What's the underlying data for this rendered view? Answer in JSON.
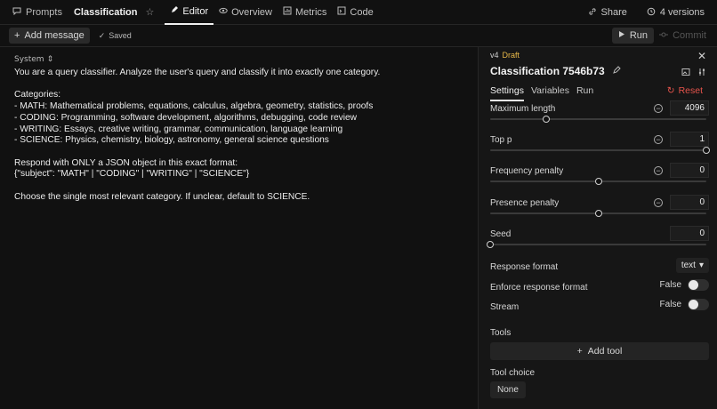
{
  "topbar": {
    "prompts_label": "Prompts",
    "prompt_name": "Classification",
    "tabs": [
      {
        "label": "Editor"
      },
      {
        "label": "Overview"
      },
      {
        "label": "Metrics"
      },
      {
        "label": "Code"
      }
    ],
    "share_label": "Share",
    "versions_label": "4 versions"
  },
  "subbar": {
    "add_message_label": "Add message",
    "saved_label": "Saved",
    "run_label": "Run",
    "commit_label": "Commit"
  },
  "editor": {
    "role_label": "System",
    "lines": [
      "You are a query classifier. Analyze the user's query and classify it into exactly one category.",
      "",
      "Categories:",
      "- MATH: Mathematical problems, equations, calculus, algebra, geometry, statistics, proofs",
      "- CODING: Programming, software development, algorithms, debugging, code review",
      "- WRITING: Essays, creative writing, grammar, communication, language learning",
      "- SCIENCE: Physics, chemistry, biology, astronomy, general science questions",
      "",
      "Respond with ONLY a JSON object in this exact format:",
      "{\"subject\": \"MATH\" | \"CODING\" | \"WRITING\" | \"SCIENCE\"}",
      "",
      "Choose the single most relevant category. If unclear, default to SCIENCE."
    ]
  },
  "panel": {
    "version": "v4",
    "status": "Draft",
    "title": "Classification 7546b73",
    "tabs": [
      "Settings",
      "Variables",
      "Run"
    ],
    "reset_label": "Reset",
    "params": [
      {
        "label": "Maximum length",
        "value": "4096",
        "slider_fraction": 0.26
      },
      {
        "label": "Top p",
        "value": "1",
        "slider_fraction": 1.0
      },
      {
        "label": "Frequency penalty",
        "value": "0",
        "slider_fraction": 0.5
      },
      {
        "label": "Presence penalty",
        "value": "0",
        "slider_fraction": 0.5
      },
      {
        "label": "Seed",
        "value": "0",
        "slider_fraction": 0.0
      }
    ],
    "response_format": {
      "label": "Response format",
      "value": "text"
    },
    "enforce": {
      "label": "Enforce response format",
      "value": "False"
    },
    "stream": {
      "label": "Stream",
      "value": "False"
    },
    "tools_label": "Tools",
    "add_tool_label": "Add tool",
    "tool_choice_label": "Tool choice",
    "tool_choice_value": "None"
  },
  "colors": {
    "background": "#111111",
    "panel_bg": "#161616",
    "draft": "#e9b949",
    "reset": "#e5534b"
  }
}
